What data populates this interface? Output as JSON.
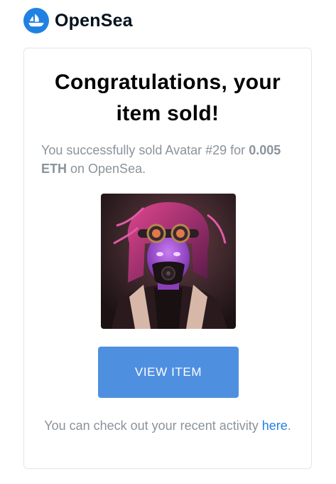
{
  "header": {
    "logo_icon": "opensea-logo-icon",
    "brand": "OpenSea",
    "logo_color": "#2081e2"
  },
  "card": {
    "title": "Congratulations, your item sold!",
    "message": {
      "prefix": "You successfully sold Avatar #29 for ",
      "amount": "0.005 ETH",
      "suffix": " on OpenSea."
    },
    "item_image": {
      "icon": "avatar-nft-image",
      "description_name": "Avatar #29"
    },
    "button": {
      "label": "VIEW ITEM",
      "color": "#4f8fe0"
    },
    "footer": {
      "text": "You can check out your recent activity ",
      "link_text": "here",
      "trailing": ".",
      "link_color": "#2081e2"
    }
  }
}
